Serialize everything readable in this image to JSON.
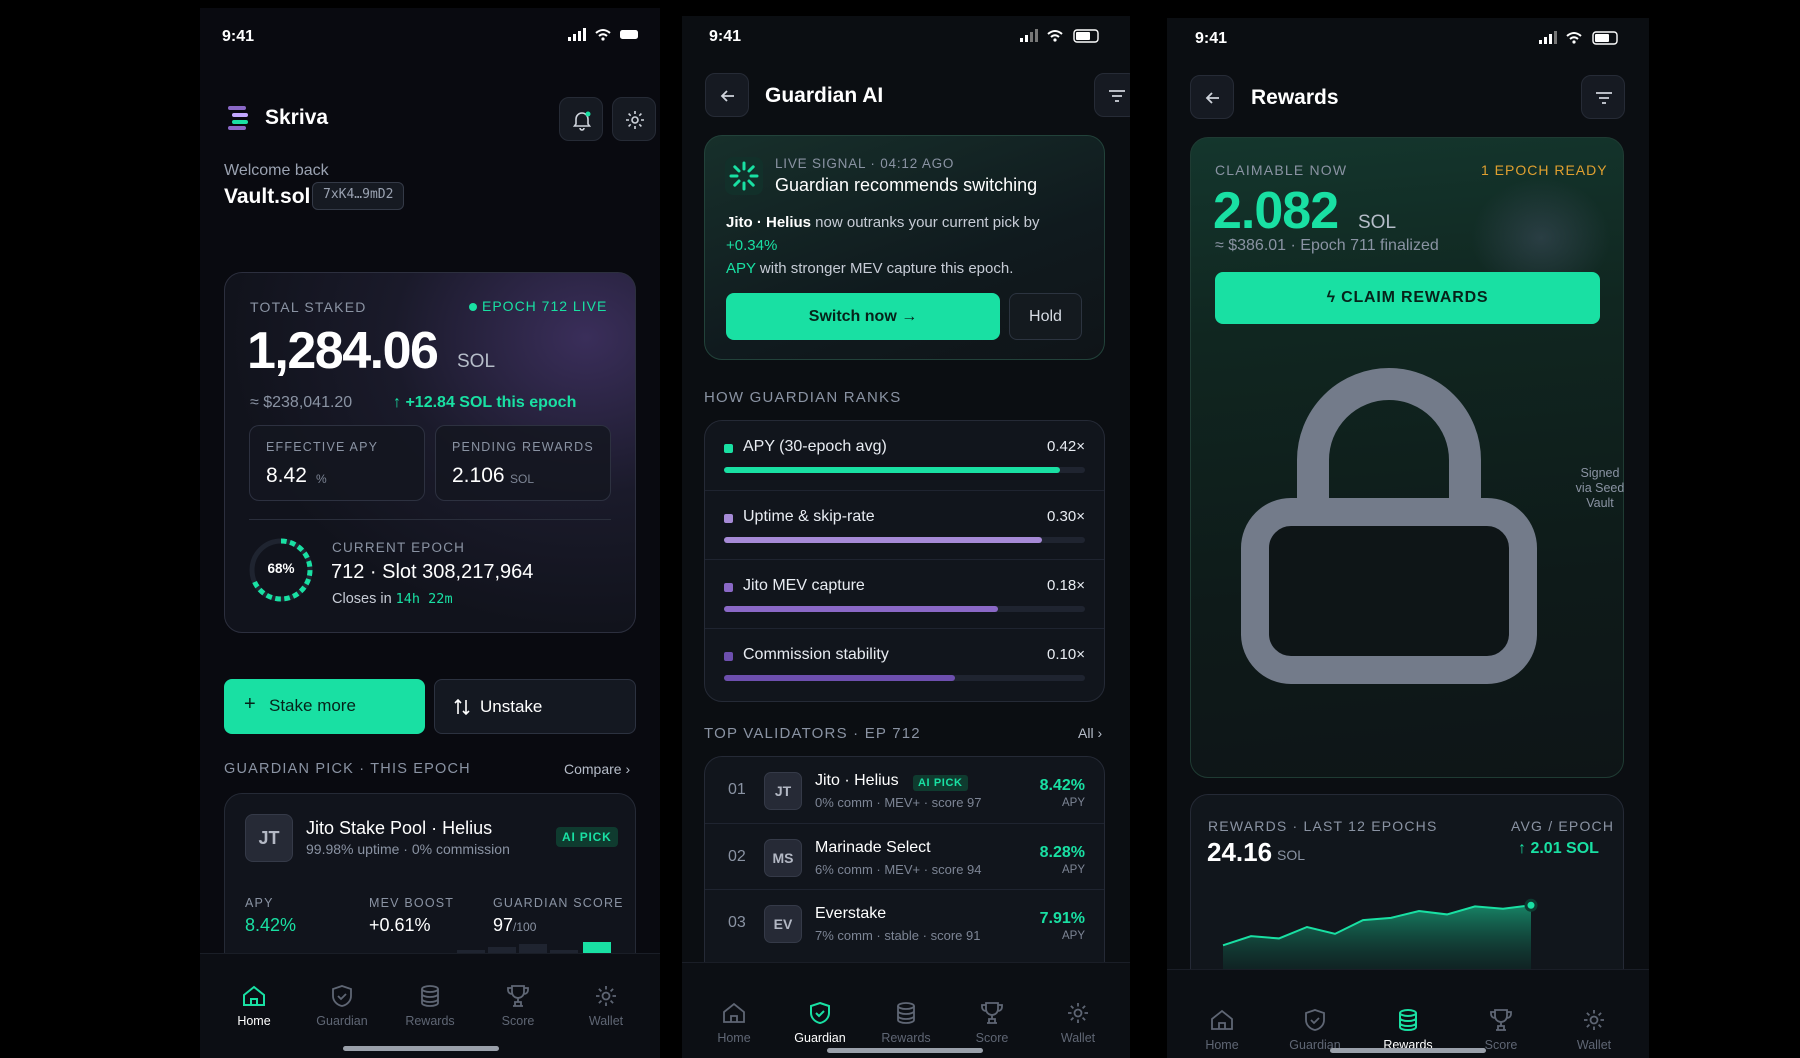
{
  "status": {
    "time": "9:41"
  },
  "home": {
    "app_name": "Skriva",
    "welcome": "Welcome back",
    "vault": "Vault.sol",
    "address": "7xK4…9mD2",
    "total_staked_label": "TOTAL STAKED",
    "epoch_live": "EPOCH 712 LIVE",
    "total_value": "1,284.06",
    "total_unit": "SOL",
    "usd": "≈ $238,041.20",
    "change": "+12.84 SOL this epoch",
    "apy_label": "EFFECTIVE APY",
    "apy_value": "8.42",
    "apy_unit": "%",
    "pending_label": "PENDING REWARDS",
    "pending_value": "2.106",
    "pending_unit": "SOL",
    "epoch_progress": 0.68,
    "epoch_pct": "68%",
    "current_epoch_label": "CURRENT EPOCH",
    "epoch_slot": "712 · Slot 308,217,964",
    "closes_in_label": "Closes in",
    "closes_in": "14h 22m",
    "stake_more": "Stake more",
    "unstake": "Unstake",
    "guardian_pick_label": "GUARDIAN PICK · THIS EPOCH",
    "compare": "Compare ›",
    "pick_initials": "JT",
    "pick_name": "Jito Stake Pool · Helius",
    "pick_meta": "99.98% uptime · 0% commission",
    "ai_pick": "AI PICK",
    "stat1_label": "APY",
    "stat1_value": "8.42%",
    "stat2_label": "MEV BOOST",
    "stat2_value": "+0.61%",
    "stat3_label": "GUARDIAN SCORE",
    "stat3_value": "97",
    "stat3_unit": "/100"
  },
  "guardian": {
    "title": "Guardian AI",
    "signal_meta": "LIVE SIGNAL · 04:12 AGO",
    "signal_title": "Guardian recommends switching",
    "body_strong": "Jito · Helius",
    "body_rest": " now outranks your current pick by",
    "body_delta": "+0.34%",
    "body_apy": "APY",
    "body_tail": " with stronger MEV capture this epoch.",
    "switch": "Switch now",
    "hold": "Hold",
    "ranks_label": "HOW GUARDIAN RANKS",
    "ranks": [
      {
        "label": "APY (30-epoch avg)",
        "weight": "0.42×",
        "fill": 0.93,
        "color": "#19e0a3"
      },
      {
        "label": "Uptime & skip-rate",
        "weight": "0.30×",
        "fill": 0.88,
        "color": "#a68ad6"
      },
      {
        "label": "Jito MEV capture",
        "weight": "0.18×",
        "fill": 0.76,
        "color": "#8a68c6"
      },
      {
        "label": "Commission stability",
        "weight": "0.10×",
        "fill": 0.64,
        "color": "#6d4fae"
      }
    ],
    "top_label": "TOP VALIDATORS · EP 712",
    "all": "All ›",
    "validators": [
      {
        "rank": "01",
        "init": "JT",
        "name": "Jito · Helius",
        "badge": "AI PICK",
        "meta": "0% comm · MEV+ · score 97",
        "apy": "8.42%",
        "apy_label": "APY"
      },
      {
        "rank": "02",
        "init": "MS",
        "name": "Marinade Select",
        "badge": "",
        "meta": "6% comm · MEV+ · score 94",
        "apy": "8.28%",
        "apy_label": "APY"
      },
      {
        "rank": "03",
        "init": "EV",
        "name": "Everstake",
        "badge": "",
        "meta": "7% comm · stable · score 91",
        "apy": "7.91%",
        "apy_label": "APY"
      }
    ]
  },
  "rewards": {
    "title": "Rewards",
    "claimable_label": "CLAIMABLE NOW",
    "epoch_ready": "1 EPOCH READY",
    "claim_value": "2.082",
    "claim_unit": "SOL",
    "claim_usd": "≈ $386.01 · Epoch 711 finalized",
    "claim_button": "CLAIM REWARDS",
    "signed": "Signed via Seed Vault",
    "chart_label": "REWARDS · LAST 12 EPOCHS",
    "avg_label": "AVG / EPOCH",
    "total": "24.16",
    "total_unit": "SOL",
    "avg_value": "↑ 2.01 SOL"
  },
  "nav": {
    "home": "Home",
    "guardian": "Guardian",
    "rewards": "Rewards",
    "score": "Score",
    "wallet": "Wallet"
  },
  "colors": {
    "accent": "#19e0a3",
    "purple": "#8a68c6",
    "warn": "#e0a030"
  },
  "chart_data": {
    "type": "area",
    "x": [
      1,
      2,
      3,
      4,
      5,
      6,
      7,
      8,
      9,
      10,
      11,
      12
    ],
    "values": [
      1.86,
      1.94,
      1.92,
      2.02,
      1.96,
      2.08,
      2.1,
      2.16,
      2.13,
      2.2,
      2.18,
      2.21
    ],
    "title": "REWARDS · LAST 12 EPOCHS",
    "xlabel": "",
    "ylabel": "",
    "grid": false
  }
}
